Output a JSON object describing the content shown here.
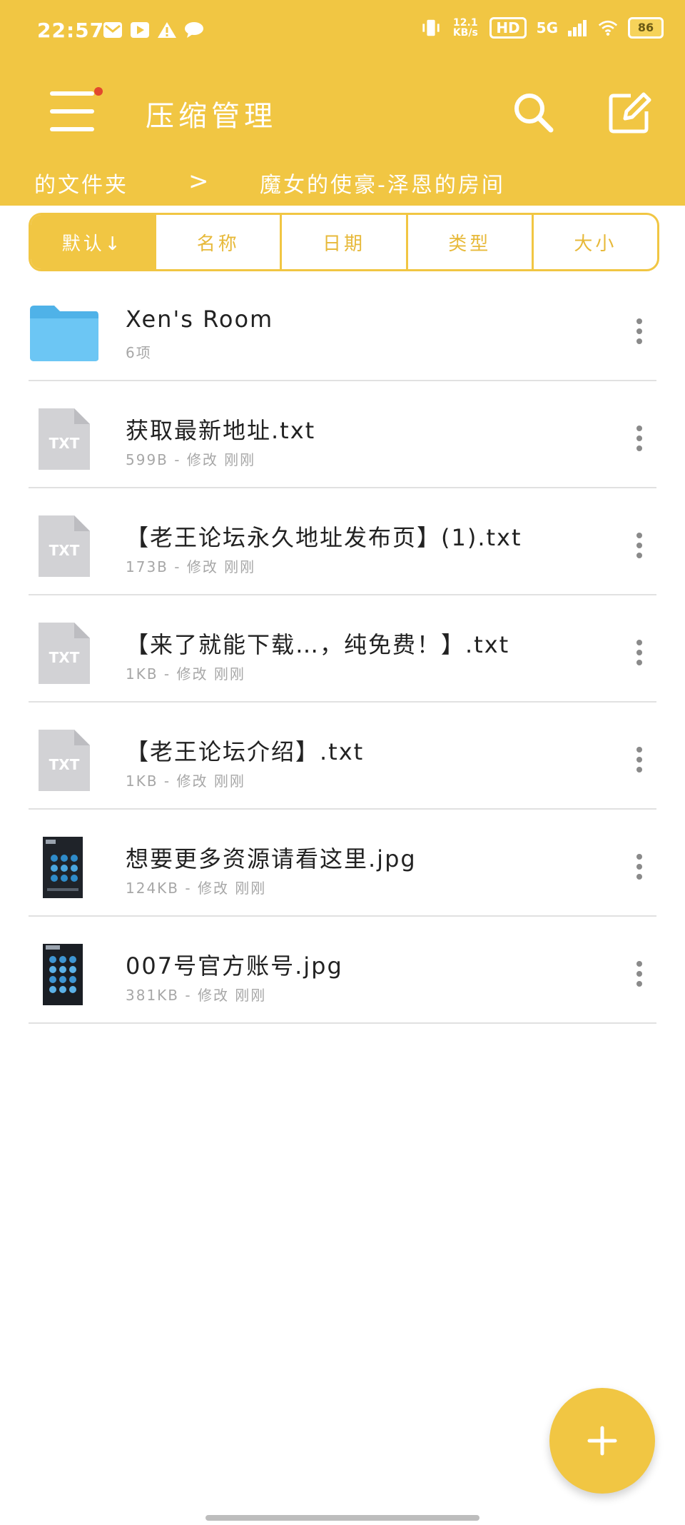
{
  "status_bar": {
    "time": "22:57",
    "net_speed": "12.1 KB/s",
    "hd": "HD",
    "signal": "5G",
    "battery": "86"
  },
  "header": {
    "title": "压缩管理",
    "notification_dot_color": "#E2482D"
  },
  "breadcrumb": {
    "items": [
      "的文件夹",
      "魔女的使豪-泽恩的房间"
    ],
    "separator": ">"
  },
  "sort": {
    "options": [
      "默认↓",
      "名称",
      "日期",
      "类型",
      "大小"
    ],
    "selected_index": 0
  },
  "files": [
    {
      "name": "Xen's Room",
      "meta": "6项",
      "type": "folder",
      "icon": "folder-icon"
    },
    {
      "name": "获取最新地址.txt",
      "meta": "599B - 修改 刚刚",
      "type": "txt",
      "icon": "txt-file-icon",
      "badge": "TXT"
    },
    {
      "name": "【老王论坛永久地址发布页】(1).txt",
      "meta": "173B - 修改 刚刚",
      "type": "txt",
      "icon": "txt-file-icon",
      "badge": "TXT"
    },
    {
      "name": "【来了就能下载…，纯免费！】.txt",
      "meta": "1KB - 修改 刚刚",
      "type": "txt",
      "icon": "txt-file-icon",
      "badge": "TXT"
    },
    {
      "name": "【老王论坛介绍】.txt",
      "meta": "1KB - 修改 刚刚",
      "type": "txt",
      "icon": "txt-file-icon",
      "badge": "TXT"
    },
    {
      "name": "想要更多资源请看这里.jpg",
      "meta": "124KB - 修改 刚刚",
      "type": "jpg",
      "icon": "image-thumbnail"
    },
    {
      "name": "007号官方账号.jpg",
      "meta": "381KB - 修改 刚刚",
      "type": "jpg",
      "icon": "image-thumbnail"
    }
  ],
  "colors": {
    "accent": "#F1C643",
    "folder": "#5BBEF0",
    "txt_icon": "#D2D2D5"
  }
}
